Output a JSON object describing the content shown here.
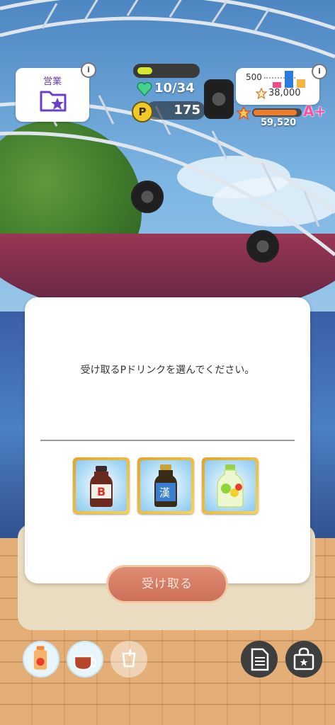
{
  "hud": {
    "eigyo_label": "営業",
    "info_glyph": "i",
    "stamina": {
      "current": 10,
      "max": 34,
      "text": "10/34",
      "fill_fraction": 0.25
    },
    "p_coin_glyph": "P",
    "p_points": "175",
    "fan": {
      "goal": "500",
      "count": "38,000"
    },
    "rank": {
      "badge": "A+",
      "points": "59,520",
      "fill_fraction": 0.92
    }
  },
  "dialog": {
    "message": "受け取るPドリンクを選んでください。",
    "items": [
      {
        "name": "B drink",
        "label": "B",
        "color": "#d8342a"
      },
      {
        "name": "blue drink",
        "label": "漢",
        "color": "#1f66b8"
      },
      {
        "name": "green drink",
        "label": "",
        "color": "#8fd43a"
      }
    ],
    "receive_label": "受け取る"
  },
  "bottom_bar": {
    "icons": [
      "strawberry-drink-icon",
      "tea-cup-icon",
      "empty-cup-icon",
      "memo-icon",
      "shop-bag-icon"
    ]
  },
  "colors": {
    "accent": "#6b3fc7",
    "button": "#d67a62",
    "rank": "#f07b2a"
  }
}
